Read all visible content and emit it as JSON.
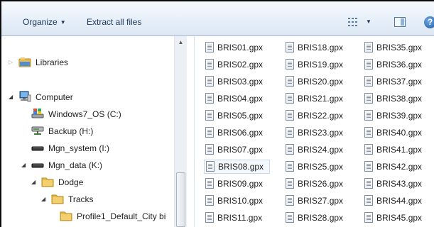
{
  "toolbar": {
    "organize_label": "Organize",
    "extract_label": "Extract all files",
    "help_label": "?"
  },
  "nav": {
    "libraries": "Libraries",
    "computer": "Computer",
    "drives": [
      "Windows7_OS (C:)",
      "Backup (H:)",
      "Mgn_system (I:)",
      "Mgn_data (K:)"
    ],
    "folders": [
      "Dodge",
      "Tracks",
      "Profile1_Default_City bi"
    ]
  },
  "files": {
    "columns": [
      [
        "BRIS01.gpx",
        "BRIS02.gpx",
        "BRIS03.gpx",
        "BRIS04.gpx",
        "BRIS05.gpx",
        "BRIS06.gpx",
        "BRIS07.gpx",
        "BRIS08.gpx",
        "BRIS09.gpx",
        "BRIS10.gpx",
        "BRIS11.gpx"
      ],
      [
        "BRIS18.gpx",
        "BRIS19.gpx",
        "BRIS20.gpx",
        "BRIS21.gpx",
        "BRIS22.gpx",
        "BRIS23.gpx",
        "BRIS24.gpx",
        "BRIS25.gpx",
        "BRIS26.gpx",
        "BRIS27.gpx",
        "BRIS28.gpx"
      ],
      [
        "BRIS35.gpx",
        "BRIS36.gpx",
        "BRIS37.gpx",
        "BRIS38.gpx",
        "BRIS39.gpx",
        "BRIS40.gpx",
        "BRIS41.gpx",
        "BRIS42.gpx",
        "BRIS43.gpx",
        "BRIS44.gpx",
        "BRIS45.gpx"
      ]
    ],
    "selected": "BRIS08.gpx"
  },
  "colors": {
    "toolbar_text": "#1e395b",
    "selection_border": "#c7d9ee",
    "folder": "#e8b84a"
  }
}
